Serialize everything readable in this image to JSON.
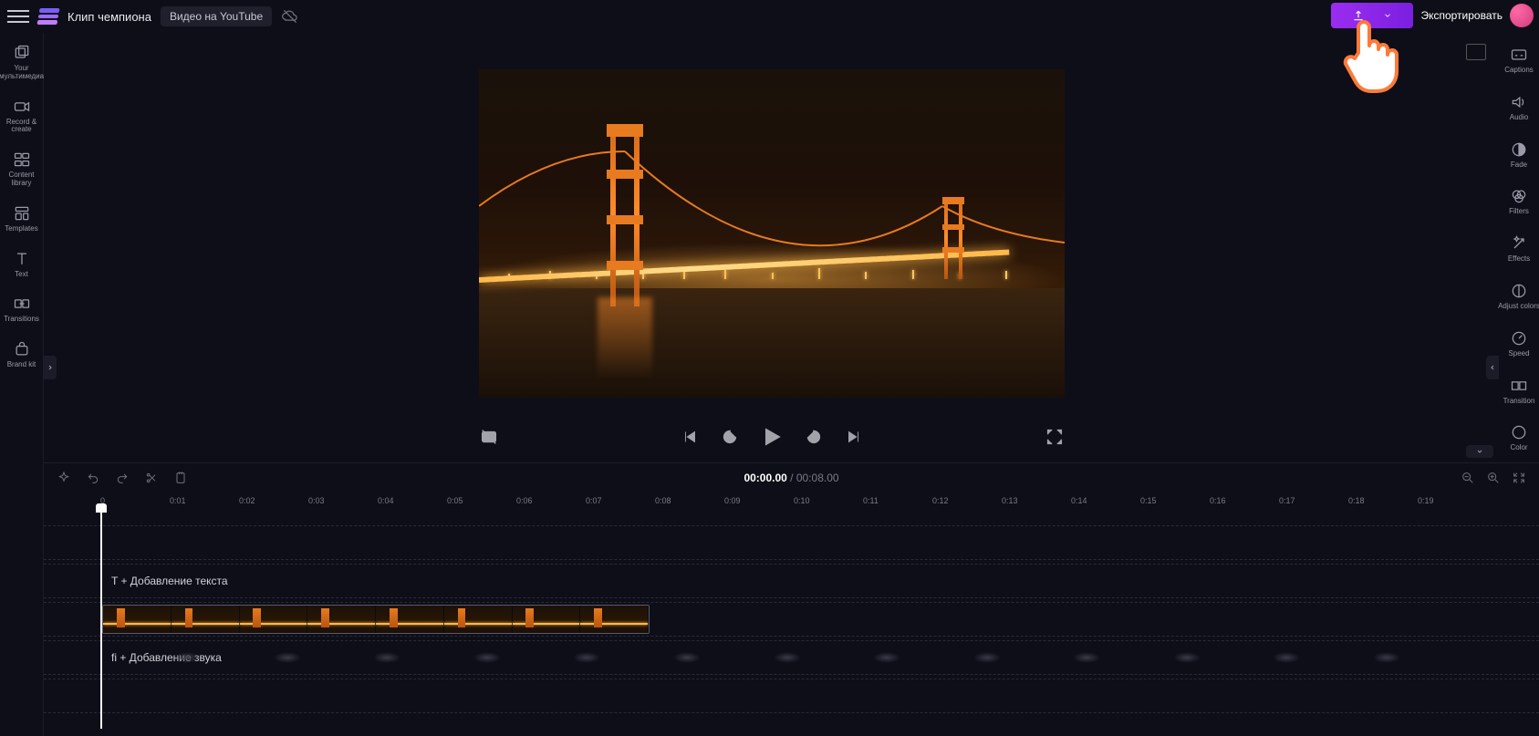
{
  "header": {
    "project_name": "Клип чемпиона",
    "video_type": "Видео на YouTube",
    "export_label": "Экспортировать"
  },
  "left_rail": [
    {
      "id": "your-media",
      "label": "Your мультимедиа"
    },
    {
      "id": "record-create",
      "label": "Record & create"
    },
    {
      "id": "content-library",
      "label": "Content library"
    },
    {
      "id": "templates",
      "label": "Templates"
    },
    {
      "id": "text",
      "label": "Text"
    },
    {
      "id": "transitions",
      "label": "Transitions"
    },
    {
      "id": "brand-kit",
      "label": "Brand kit"
    }
  ],
  "right_rail": [
    {
      "id": "captions",
      "label": "Captions"
    },
    {
      "id": "audio",
      "label": "Audio"
    },
    {
      "id": "fade",
      "label": "Fade"
    },
    {
      "id": "filters",
      "label": "Filters"
    },
    {
      "id": "effects",
      "label": "Effects"
    },
    {
      "id": "adjust-colors",
      "label": "Adjust colors"
    },
    {
      "id": "speed",
      "label": "Speed"
    },
    {
      "id": "transition",
      "label": "Transition"
    },
    {
      "id": "color",
      "label": "Color"
    }
  ],
  "timeline": {
    "current": "00:00.00",
    "separator": " / ",
    "total": "00:08.00",
    "ticks": [
      "0",
      "0:01",
      "0:02",
      "0:03",
      "0:04",
      "0:05",
      "0:06",
      "0:07",
      "0:08",
      "0:09",
      "0:10",
      "0:11",
      "0:12",
      "0:13",
      "0:14",
      "0:15",
      "0:16",
      "0:17",
      "0:18",
      "0:19"
    ],
    "text_track_hint": "T + Добавление текста",
    "audio_track_hint": "fi + Добавление звука"
  },
  "colors": {
    "accent": "#8a2be2",
    "bridge": "#e87a1f"
  }
}
